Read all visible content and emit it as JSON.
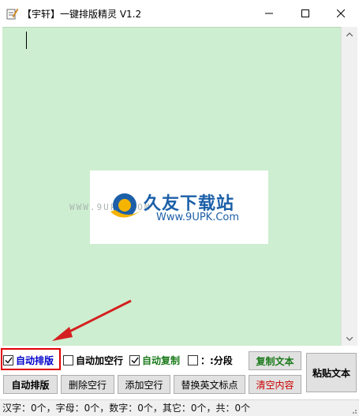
{
  "window": {
    "title": "【宇轩】一键排版精灵 V1.2"
  },
  "watermark": {
    "url_text": "WWW.9UPK.COM",
    "brand_cn": "久友下载站",
    "brand_url": "Www.9UPK.Com"
  },
  "options": {
    "auto_format": {
      "label": "自动排版",
      "checked": true,
      "color": "#0000cc"
    },
    "auto_blank_line": {
      "label": "自动加空行",
      "checked": false
    },
    "auto_copy": {
      "label": "自动复制",
      "checked": true,
      "color": "#1a7a1a"
    },
    "segment": {
      "label": "：:分段",
      "checked": false
    }
  },
  "buttons": {
    "copy_text": "复制文本",
    "paste_text": "粘贴文本",
    "auto_format": "自动排版",
    "delete_blank": "删除空行",
    "add_blank": "添加空行",
    "replace_punct": "替换英文标点",
    "clear": "清空内容"
  },
  "status": {
    "text": "汉字：0个，字母：0个，数字：0个，其它：0个，共：0个"
  },
  "colors": {
    "editor_bg": "#cdeed0",
    "highlight": "#e00000",
    "arrow": "#d42020"
  }
}
